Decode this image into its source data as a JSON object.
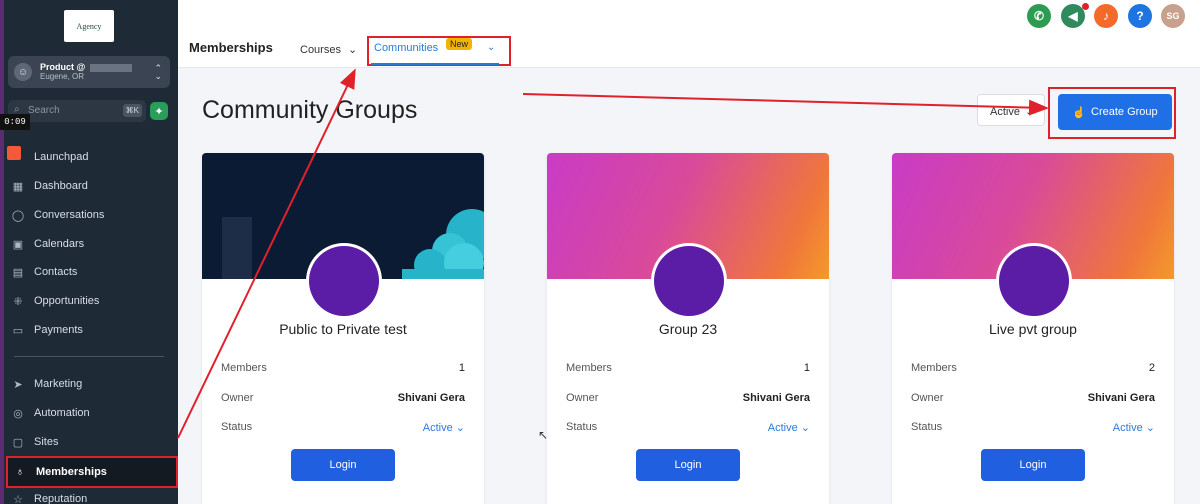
{
  "sidebar": {
    "logo_text": "Agency",
    "account": {
      "name": "Product @",
      "location": "Eugene, OR"
    },
    "search": {
      "placeholder": "Search",
      "shortcut": "⌘K"
    },
    "timer": "0:09",
    "items": [
      {
        "label": "Launchpad",
        "icon": "rocket-icon"
      },
      {
        "label": "Dashboard",
        "icon": "grid-icon"
      },
      {
        "label": "Conversations",
        "icon": "chat-icon"
      },
      {
        "label": "Calendars",
        "icon": "calendar-icon"
      },
      {
        "label": "Contacts",
        "icon": "contacts-icon"
      },
      {
        "label": "Opportunities",
        "icon": "funnel-icon"
      },
      {
        "label": "Payments",
        "icon": "payment-icon"
      },
      {
        "label": "Marketing",
        "icon": "send-icon"
      },
      {
        "label": "Automation",
        "icon": "automation-icon"
      },
      {
        "label": "Sites",
        "icon": "globe-icon"
      },
      {
        "label": "Memberships",
        "icon": "badge-icon",
        "active": true
      },
      {
        "label": "Reputation",
        "icon": "star-icon"
      }
    ]
  },
  "topbar": {
    "title": "Memberships",
    "tabs": [
      {
        "label": "Courses",
        "has_dropdown": true
      },
      {
        "label": "Communities",
        "badge": "New",
        "active": true,
        "has_dropdown": true
      }
    ],
    "actions": [
      {
        "icon": "phone-icon",
        "color": "#2e9b52"
      },
      {
        "icon": "megaphone-icon",
        "color": "#2f8a5e"
      },
      {
        "icon": "bell-icon",
        "color": "#f36a2a"
      },
      {
        "icon": "help-icon",
        "color": "#1d75e0",
        "text": "?"
      },
      {
        "icon": "user-avatar",
        "color": "#c9a08c",
        "text": "SG"
      }
    ]
  },
  "main": {
    "title": "Community Groups",
    "filter": {
      "selected": "Active"
    },
    "create_button": "Create Group",
    "row_labels": {
      "members": "Members",
      "owner": "Owner",
      "status": "Status"
    },
    "login_label": "Login",
    "groups": [
      {
        "name": "Public to Private test",
        "members": "1",
        "owner": "Shivani Gera",
        "status": "Active",
        "banner": "dark"
      },
      {
        "name": "Group 23",
        "members": "1",
        "owner": "Shivani Gera",
        "status": "Active",
        "banner": "gradient"
      },
      {
        "name": "Live pvt group",
        "members": "2",
        "owner": "Shivani Gera",
        "status": "Active",
        "banner": "gradient"
      }
    ]
  },
  "colors": {
    "accent": "#1f6fe6",
    "annotation": "#e0212b",
    "sidebar_bg": "#1f2a37"
  }
}
